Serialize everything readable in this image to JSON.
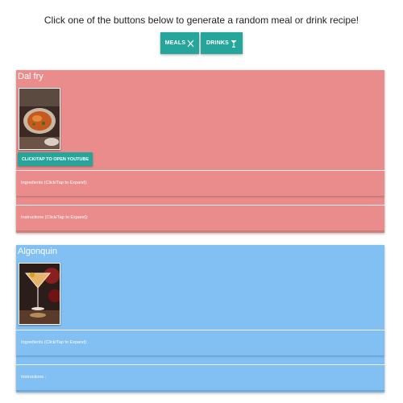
{
  "header": {
    "instruction": "Click one of the buttons below to generate a random meal or drink recipe!",
    "meals_label": "MEALS",
    "drinks_label": "DRINKS"
  },
  "meal_card": {
    "title": "Dal fry",
    "youtube_button": "CLICK/TAP TO OPEN YOUTUBE",
    "ingredients_label": "Ingredients (Click/Tap to Expand):",
    "instructions_label": "Instructions (Click/Tap to Expand):"
  },
  "drink_card": {
    "title": "Algonquin",
    "ingredients_label": "Ingredients (Click/Tap to Expand):",
    "instructions_label": "Instructions :"
  },
  "colors": {
    "button_teal": "#26a69a",
    "meal_card_bg": "#ea8c8c",
    "drink_card_bg": "#82bff2"
  },
  "icons": {
    "meals": "fork-knife-icon",
    "drinks": "cocktail-glass-icon"
  }
}
